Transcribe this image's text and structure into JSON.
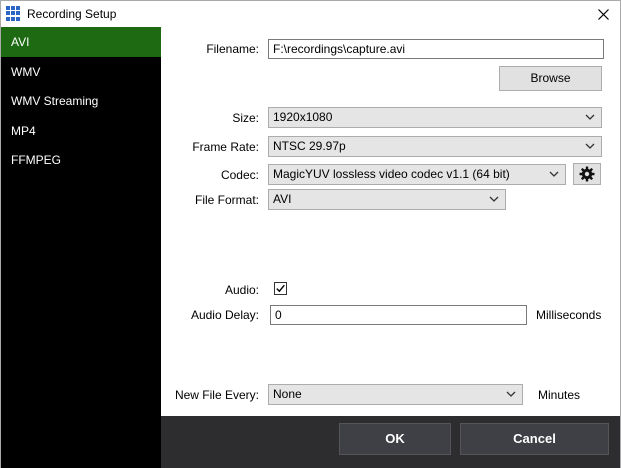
{
  "window": {
    "title": "Recording Setup"
  },
  "sidebar": {
    "items": [
      {
        "label": "AVI"
      },
      {
        "label": "WMV"
      },
      {
        "label": "WMV Streaming"
      },
      {
        "label": "MP4"
      },
      {
        "label": "FFMPEG"
      }
    ],
    "active_index": 0,
    "active_color": "#1e6a12"
  },
  "form": {
    "filename": {
      "label": "Filename:",
      "value": "F:\\recordings\\capture.avi"
    },
    "browse_label": "Browse",
    "size": {
      "label": "Size:",
      "value": "1920x1080"
    },
    "frame_rate": {
      "label": "Frame Rate:",
      "value": "NTSC 29.97p"
    },
    "codec": {
      "label": "Codec:",
      "value": "MagicYUV lossless video codec v1.1 (64 bit)"
    },
    "file_format": {
      "label": "File Format:",
      "value": "AVI"
    },
    "audio": {
      "label": "Audio:",
      "checked": true
    },
    "audio_delay": {
      "label": "Audio Delay:",
      "value": "0",
      "unit": "Milliseconds"
    },
    "new_file_every": {
      "label": "New File Every:",
      "value": "None",
      "unit": "Minutes"
    }
  },
  "footer": {
    "ok_label": "OK",
    "cancel_label": "Cancel"
  }
}
